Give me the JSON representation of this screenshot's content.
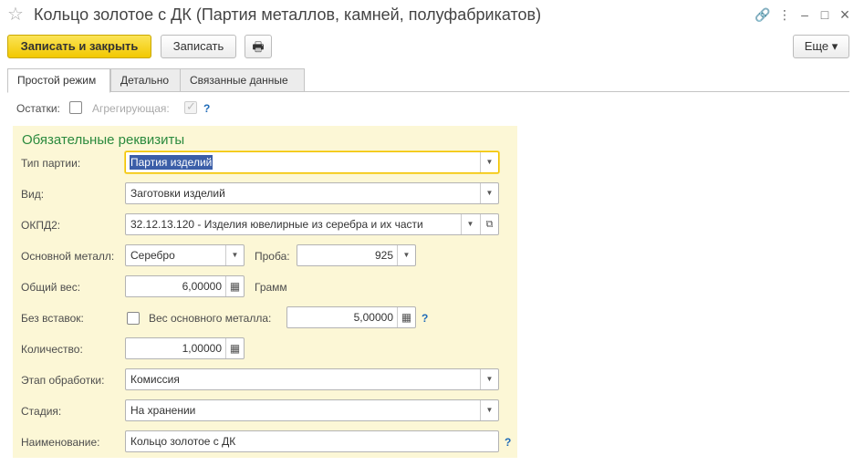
{
  "window": {
    "title": "Кольцо золотое с ДК (Партия металлов, камней, полуфабрикатов)",
    "link_icon": "🔗",
    "more_icon": "⋮",
    "min_icon": "–",
    "max_icon": "□",
    "close_icon": "×"
  },
  "toolbar": {
    "save_close": "Записать и закрыть",
    "save": "Записать",
    "print_icon": "🖶",
    "more": "Еще ▾"
  },
  "tabs": [
    "Простой режим",
    "Детально",
    "Связанные данные"
  ],
  "options": {
    "remains_label": "Остатки:",
    "aggregating_label": "Агрегирующая:",
    "help": "?"
  },
  "group": {
    "title": "Обязательные реквизиты",
    "batch_type": {
      "label": "Тип партии:",
      "value": "Партия изделий"
    },
    "kind": {
      "label": "Вид:",
      "value": "Заготовки изделий"
    },
    "okpd2": {
      "label": "ОКПД2:",
      "value": "32.12.13.120 - Изделия ювелирные из серебра и их части"
    },
    "metal": {
      "label": "Основной металл:",
      "value": "Серебро"
    },
    "probe": {
      "label": "Проба:",
      "value": "925"
    },
    "total_weight": {
      "label": "Общий вес:",
      "value": "6,00000",
      "unit": "Грамм"
    },
    "no_inserts": {
      "label": "Без вставок:"
    },
    "metal_weight": {
      "label": "Вес основного металла:",
      "value": "5,00000"
    },
    "quantity": {
      "label": "Количество:",
      "value": "1,00000"
    },
    "stage": {
      "label": "Этап обработки:",
      "value": "Комиссия"
    },
    "status": {
      "label": "Стадия:",
      "value": "На хранении"
    },
    "name": {
      "label": "Наименование:",
      "value": "Кольцо золотое с ДК"
    },
    "help": "?"
  },
  "icons": {
    "dropdown": "▼",
    "calc": "▦",
    "open": "⧉"
  }
}
